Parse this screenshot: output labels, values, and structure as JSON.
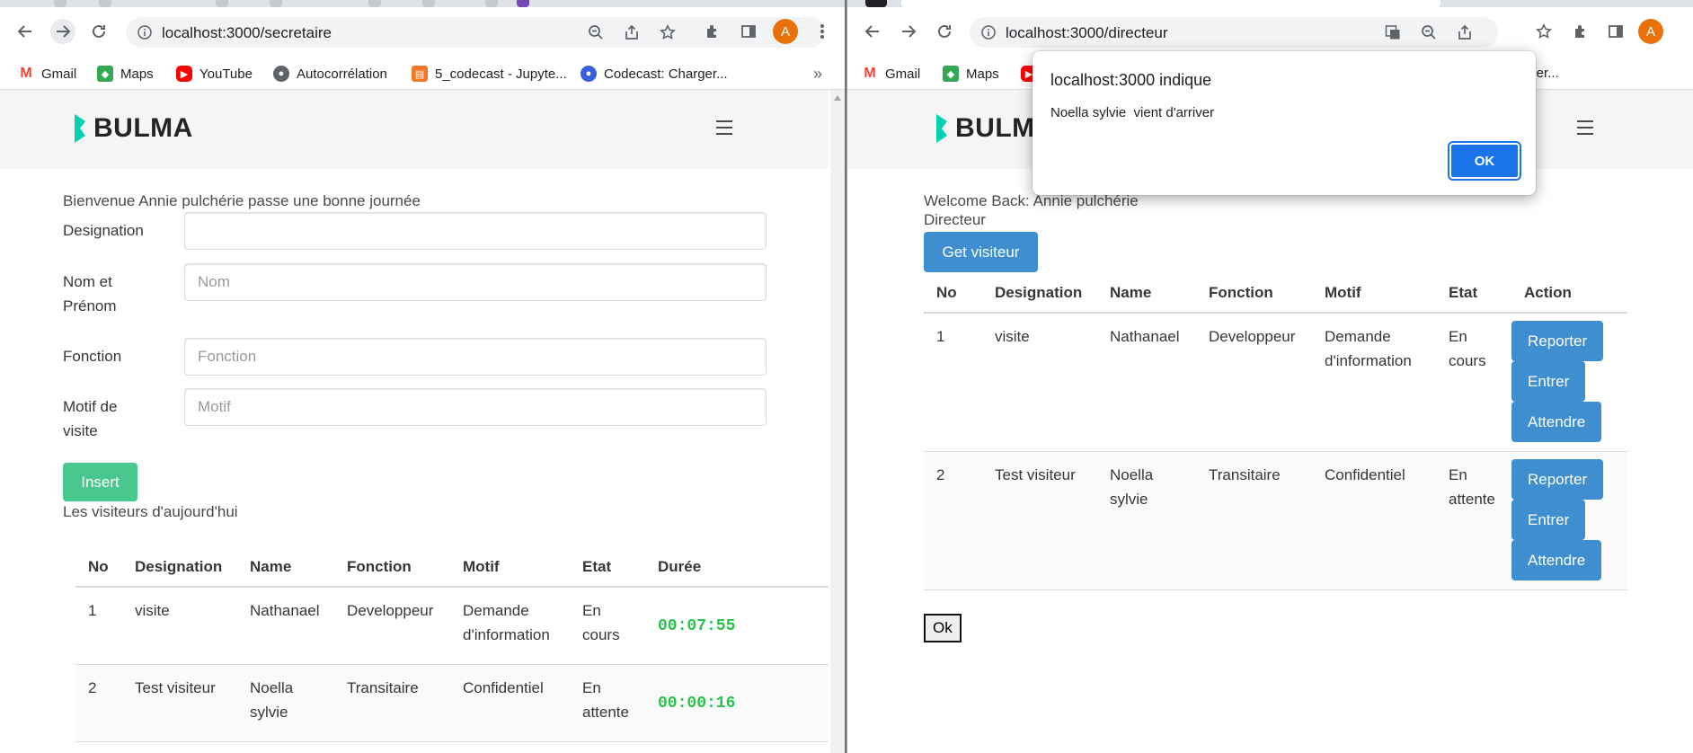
{
  "left_window": {
    "url": "localhost:3000/secretaire",
    "avatar_letter": "A",
    "bookmarks": [
      {
        "label": "Gmail",
        "icon": "gmail-icon"
      },
      {
        "label": "Maps",
        "icon": "maps-icon"
      },
      {
        "label": "YouTube",
        "icon": "youtube-icon"
      },
      {
        "label": "Autocorrélation",
        "icon": "globe-icon"
      },
      {
        "label": "5_codecast - Jupyte...",
        "icon": "jupyter-icon"
      },
      {
        "label": "Codecast: Charger...",
        "icon": "codecast-icon"
      }
    ],
    "bookmarks_more": "»",
    "logo_text": "BULMA",
    "welcome": "Bienvenue Annie pulchérie passe une bonne journée",
    "form": {
      "designation_label": "Designation",
      "designation_value": "",
      "name_label": "Nom et Prénom",
      "name_placeholder": "Nom",
      "function_label": "Fonction",
      "function_placeholder": "Fonction",
      "motif_label": "Motif de visite",
      "motif_placeholder": "Motif",
      "insert_label": "Insert"
    },
    "visitors_heading": "Les visiteurs d'aujourd'hui",
    "table": {
      "headers": [
        "No",
        "Designation",
        "Name",
        "Fonction",
        "Motif",
        "Etat",
        "Durée"
      ],
      "rows": [
        {
          "no": "1",
          "designation": "visite",
          "name": "Nathanael",
          "fonction": "Developpeur",
          "motif": "Demande d'information",
          "etat": "En cours",
          "duree": "00:07:55"
        },
        {
          "no": "2",
          "designation": "Test visiteur",
          "name": "Noella sylvie",
          "fonction": "Transitaire",
          "motif": "Confidentiel",
          "etat": "En attente",
          "duree": "00:00:16"
        }
      ]
    }
  },
  "right_window": {
    "url": "localhost:3000/directeur",
    "avatar_letter": "A",
    "bookmarks": [
      {
        "label": "Gmail",
        "icon": "gmail-icon"
      },
      {
        "label": "Maps",
        "icon": "maps-icon"
      }
    ],
    "bookmark_partial": "arger...",
    "logo_text": "BULMA",
    "welcome": "Welcome Back: Annie pulchérie",
    "role": "Directeur",
    "get_button": "Get visiteur",
    "table": {
      "headers": [
        "No",
        "Designation",
        "Name",
        "Fonction",
        "Motif",
        "Etat",
        "Action"
      ],
      "rows": [
        {
          "no": "1",
          "designation": "visite",
          "name": "Nathanael",
          "fonction": "Developpeur",
          "motif": "Demande d'information",
          "etat": "En cours"
        },
        {
          "no": "2",
          "designation": "Test visiteur",
          "name": "Noella sylvie",
          "fonction": "Transitaire",
          "motif": "Confidentiel",
          "etat": "En attente"
        }
      ],
      "action_labels": {
        "reporter": "Reporter",
        "entrer": "Entrer",
        "attendre": "Attendre"
      }
    },
    "ok_label": "Ok"
  },
  "dialog": {
    "title": "localhost:3000 indique",
    "message": "Noella sylvie  vient d'arriver",
    "ok_label": "OK"
  },
  "colors": {
    "bulma_primary": "#00d1b2",
    "button_green": "#48c78e",
    "button_blue": "#3e8ed0",
    "timer_green": "#27c24c",
    "chrome_blue": "#1a73e8"
  }
}
